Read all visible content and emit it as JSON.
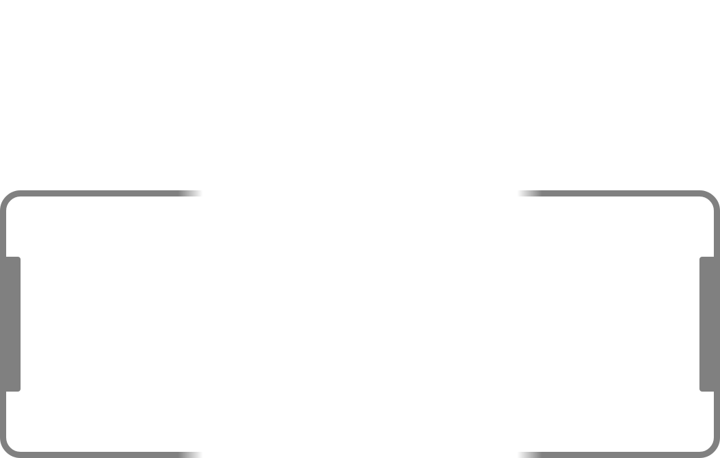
{
  "colors": {
    "frame": "#808080",
    "background": "#ffffff"
  }
}
